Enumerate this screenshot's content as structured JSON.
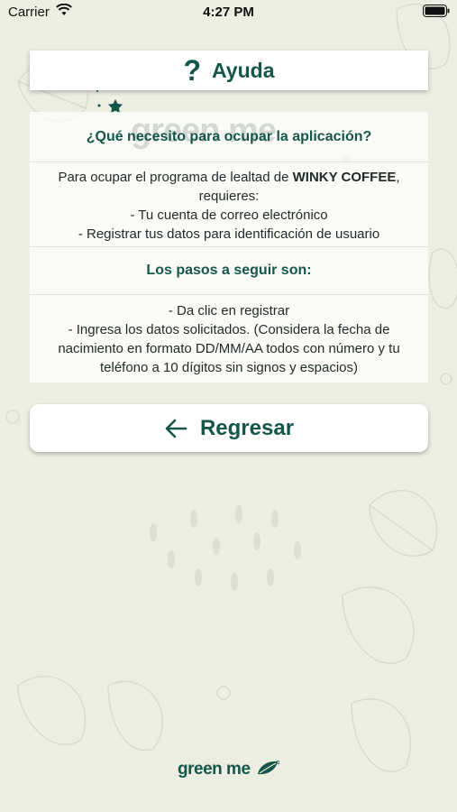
{
  "status_bar": {
    "carrier": "Carrier",
    "time": "4:27 PM"
  },
  "header": {
    "icon": "question-icon",
    "icon_glyph": "?",
    "title": "Ayuda"
  },
  "watermark": "green me",
  "info": {
    "question": "¿Qué necesito para ocupar la aplicación?",
    "description_prefix": "Para ocupar el programa de lealtad de ",
    "brand": "WINKY COFFEE",
    "description_suffix": ", requieres:",
    "requirements": [
      "- Tu cuenta de correo electrónico",
      "- Registrar tus datos para identificación de usuario"
    ],
    "steps_title": "Los pasos a seguir son:",
    "steps": [
      "- Da clic en registrar",
      "- Ingresa los datos solicitados. (Considera la fecha de nacimiento en formato DD/MM/AA todos con número y tu teléfono a 10 dígitos sin signos y espacios)"
    ]
  },
  "back_button": {
    "icon": "arrow-left-icon",
    "label": "Regresar"
  },
  "footer": {
    "logo_text": "green me"
  },
  "colors": {
    "accent": "#14564a",
    "background": "#eceee2"
  }
}
